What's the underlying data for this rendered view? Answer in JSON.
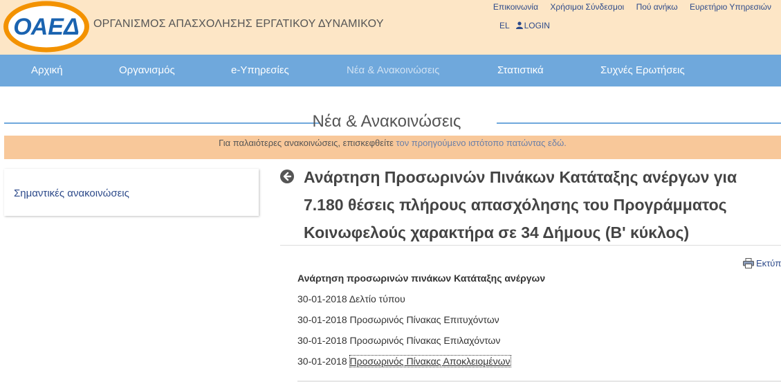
{
  "header": {
    "logo_text": "ΟΑΕΔ",
    "org_name": "ΟΡΓΑΝΙΣΜΟΣ ΑΠΑΣΧΟΛΗΣΗΣ ΕΡΓΑΤΙΚΟΥ ΔΥΝΑΜΙΚΟΥ",
    "top_links": [
      "Επικοινωνία",
      "Χρήσιμοι Σύνδεσμοι",
      "Πού ανήκω",
      "Ευρετήριο Υπηρεσιών"
    ],
    "lang": "EL",
    "login": "LOGIN"
  },
  "nav": {
    "items": [
      "Αρχική",
      "Οργανισμός",
      "e-Υπηρεσίες",
      "Νέα & Ανακοινώσεις",
      "Στατιστικά",
      "Συχνές Ερωτήσεις"
    ],
    "active": "Νέα & Ανακοινώσεις"
  },
  "section": {
    "title": "Νέα & Ανακοινώσεις",
    "banner_prefix": "Για παλαιότερες ανακοινώσεις, επισκεφθείτε ",
    "banner_link": "τον προηγούμενο ιστότοπο πατώντας εδώ."
  },
  "sidebar": {
    "items": [
      "Σημαντικές ανακοινώσεις"
    ]
  },
  "article": {
    "title": "Ανάρτηση Προσωρινών Πινάκων Κατάταξης ανέργων για 7.180 θέσεις πλήρους απασχόλησης του Προγράμματος Κοινωφελούς χαρακτήρα σε 34 Δήμους (Β' κύκλος)",
    "print_label": "Εκτύπωση",
    "list_heading": "Ανάρτηση προσωρινών πινάκων Κατάταξης ανέργων",
    "items": [
      {
        "date": "30-01-2018",
        "label": "Δελτίο τύπου"
      },
      {
        "date": "30-01-2018",
        "label": "Προσωρινός Πίνακας Επιτυχόντων"
      },
      {
        "date": "30-01-2018",
        "label": "Προσωρινός Πίνακας Επιλαχόντων"
      },
      {
        "date": "30-01-2018",
        "label": "Προσωρινός Πίνακας Αποκλειομένων"
      }
    ]
  },
  "colors": {
    "header_bg": "#fde6c6",
    "nav_bg": "#6fa8dc",
    "banner_bg": "#f8c89a",
    "logo_orange": "#f39200",
    "logo_blue": "#1a63b0"
  }
}
